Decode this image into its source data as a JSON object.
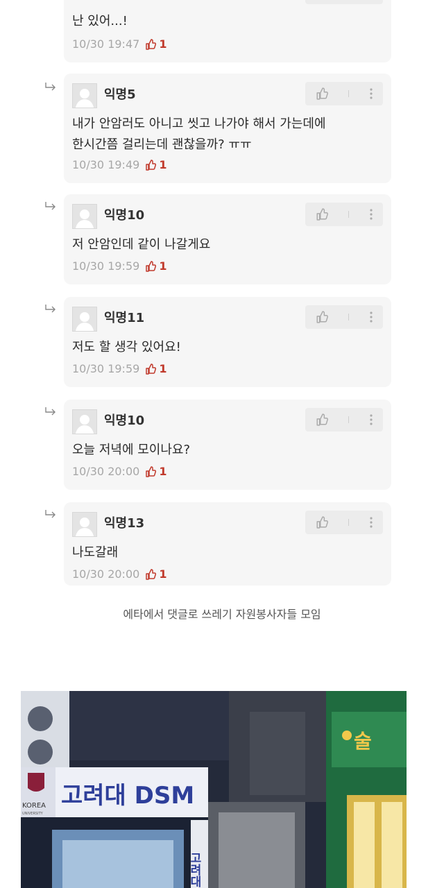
{
  "comments": [
    {
      "author": "",
      "text": "난 있어...!",
      "date": "10/30 19:47",
      "likes": "1"
    },
    {
      "author": "익명5",
      "text": "내가 안암러도 아니고 씻고 나가야 해서 가는데에\n한시간쯤 걸리는데 괜찮을까? ㅠㅠ",
      "date": "10/30 19:49",
      "likes": "1"
    },
    {
      "author": "익명10",
      "text": "저 안암인데 같이 나갈게요",
      "date": "10/30 19:59",
      "likes": "1"
    },
    {
      "author": "익명11",
      "text": "저도 할 생각 있어요!",
      "date": "10/30 19:59",
      "likes": "1"
    },
    {
      "author": "익명10",
      "text": "오늘 저녁에 모이나요?",
      "date": "10/30 20:00",
      "likes": "1"
    },
    {
      "author": "익명13",
      "text": "나도갈래",
      "date": "10/30 20:00",
      "likes": "1"
    }
  ],
  "caption": "에타에서 댓글로 쓰레기 자원봉사자들 모임",
  "photo": {
    "sign_main": "고려대 DSM",
    "sign_logo": "KOREA",
    "sign_logo_sub": "UNIVERSITY",
    "sign_vertical": "고려대",
    "sign_right": "술"
  },
  "colors": {
    "card_bg": "#f6f6f6",
    "like": "#c0392b",
    "meta": "#a7a7a7"
  }
}
